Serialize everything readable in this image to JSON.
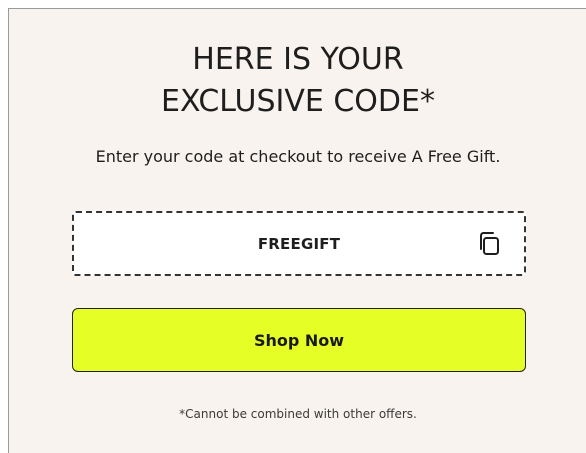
{
  "modal": {
    "title_line1": "HERE IS YOUR",
    "title_line2": "EXCLUSIVE CODE*",
    "subtitle": "Enter your code at checkout to receive A Free Gift.",
    "code": "FREEGIFT",
    "copy_icon": "copy-icon",
    "shop_button_label": "Shop Now",
    "disclaimer": "*Cannot be combined with other offers."
  },
  "colors": {
    "background": "#f8f3ef",
    "button_accent": "#e5ff26",
    "text": "#1e1e1e"
  }
}
